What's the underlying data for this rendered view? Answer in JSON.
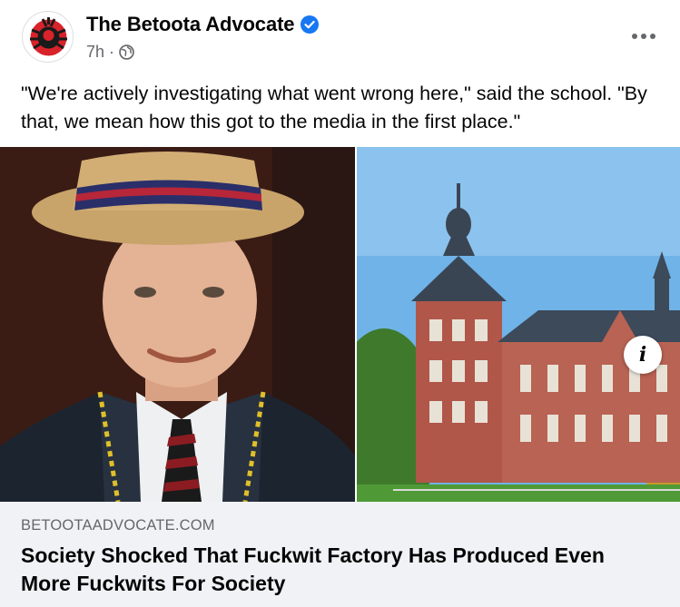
{
  "post": {
    "page_name": "The Betoota Advocate",
    "verified_icon": "verified-badge-icon",
    "timestamp": "7h",
    "separator": "·",
    "audience_icon": "globe-icon",
    "more_icon": "more-options-icon",
    "caption": "\"We're actively investigating what went wrong here,\" said the school. \"By that, we mean how this got to the media in the first place.\""
  },
  "images": {
    "left": "photo-of-student-in-boater-hat",
    "right": "photo-of-brick-castle"
  },
  "link_preview": {
    "domain": "BETOOTAADVOCATE.COM",
    "headline": "Society Shocked That Fuckwit Factory Has Produced Even More Fuckwits For Society",
    "info_icon_label": "i"
  },
  "colors": {
    "verified_blue": "#1877f2",
    "secondary_text": "#65676b",
    "preview_bg": "#f0f2f5"
  }
}
